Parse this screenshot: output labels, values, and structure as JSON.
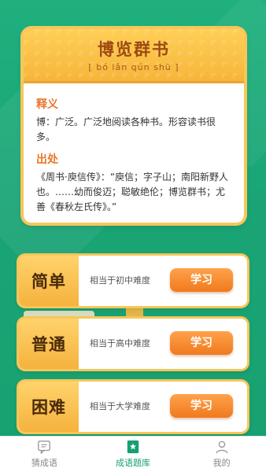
{
  "idiom": {
    "title": "博览群书",
    "pinyin": "[ bó lǎn qún shū ]",
    "meaning_heading": "释义",
    "meaning_text": "博：广泛。广泛地阅读各种书。形容读书很多。",
    "source_heading": "出处",
    "source_text": "《周书·庾信传》：“庾信；字子山；南阳新野人也。……幼而俊迈；聪敏绝伦；博览群书；尤善《春秋左氏传》。”"
  },
  "levels": [
    {
      "label": "简单",
      "description": "相当于初中难度",
      "button": "学习"
    },
    {
      "label": "普通",
      "description": "相当于高中难度",
      "button": "学习"
    },
    {
      "label": "困难",
      "description": "相当于大学难度",
      "button": "学习"
    }
  ],
  "nav": [
    {
      "label": "猜成语",
      "icon": "chat-icon",
      "active": false
    },
    {
      "label": "成语题库",
      "icon": "star-book-icon",
      "active": true
    },
    {
      "label": "我的",
      "icon": "user-icon",
      "active": false
    }
  ],
  "colors": {
    "background": "#1aa475",
    "accent": "#f07a1e",
    "gold": "#f6c659",
    "active_nav": "#17a06f"
  }
}
